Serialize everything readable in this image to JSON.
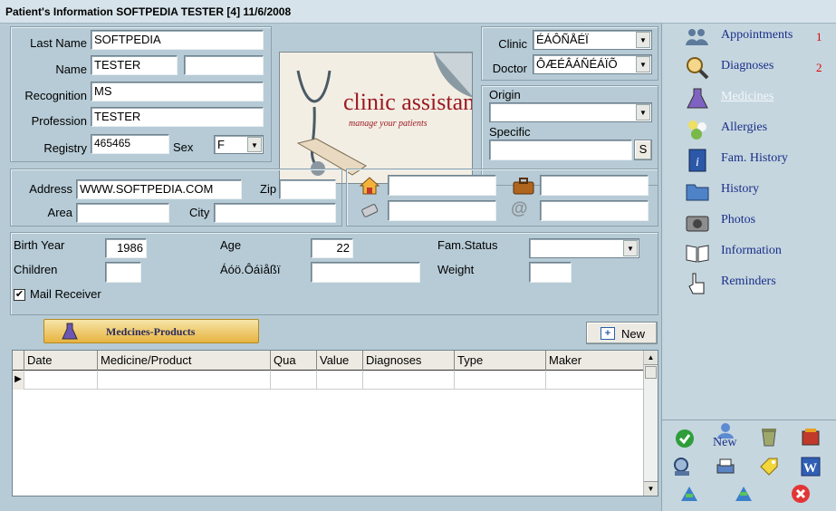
{
  "window": {
    "title": "Patient's Information SOFTPEDIA TESTER  [4] 11/6/2008"
  },
  "personal": {
    "last_name": {
      "label": "Last Name",
      "value": "SOFTPEDIA"
    },
    "name": {
      "label": "Name",
      "value": "TESTER",
      "value2": ""
    },
    "recognition": {
      "label": "Recognition",
      "value": "MS"
    },
    "profession": {
      "label": "Profession",
      "value": "TESTER"
    },
    "registry": {
      "label": "Registry",
      "value": "465465"
    },
    "sex": {
      "label": "Sex",
      "value": "F"
    }
  },
  "logo": {
    "title": "clinic assistant",
    "tagline": "manage your patients"
  },
  "assignment": {
    "clinic": {
      "label": "Clinic",
      "value": "ÉÁÔÑÅÉÏ"
    },
    "doctor": {
      "label": "Doctor",
      "value": "ÔÆÉÂÁÑÉÁÏÕ"
    },
    "origin": {
      "label": "Origin",
      "value": ""
    },
    "specific": {
      "label": "Specific",
      "value": "",
      "button": "S"
    }
  },
  "address": {
    "address": {
      "label": "Address",
      "value": "WWW.SOFTPEDIA.COM"
    },
    "zip": {
      "label": "Zip",
      "value": ""
    },
    "area": {
      "label": "Area",
      "value": ""
    },
    "city": {
      "label": "City",
      "value": ""
    }
  },
  "contacts": {
    "home_phone": "",
    "work_phone": "",
    "mobile": "",
    "email": ""
  },
  "details": {
    "birth_year": {
      "label": "Birth Year",
      "value": "1986"
    },
    "age": {
      "label": "Age",
      "value": "22"
    },
    "fam_status": {
      "label": "Fam.Status",
      "value": ""
    },
    "children": {
      "label": "Children",
      "value": ""
    },
    "extra": {
      "label": "Áóö.Ôáìåßï",
      "value": ""
    },
    "weight": {
      "label": "Weight",
      "value": ""
    },
    "mail_receiver": {
      "label": "Mail Receiver",
      "checked": true
    }
  },
  "medicines": {
    "tab_label": "Medcines-Products",
    "new_button": "New",
    "columns": [
      "Date",
      "Medicine/Product",
      "Qua",
      "Value",
      "Diagnoses",
      "Type",
      "Maker"
    ],
    "row_marker": "▶"
  },
  "sidebar": {
    "items": [
      {
        "label": "Appointments",
        "count": "1",
        "icon": "people-icon"
      },
      {
        "label": "Diagnoses",
        "count": "2",
        "icon": "magnifier-icon"
      },
      {
        "label": "Medicines",
        "count": "",
        "icon": "flask-icon"
      },
      {
        "label": "Allergies",
        "count": "",
        "icon": "flower-icon"
      },
      {
        "label": "Fam. History",
        "count": "",
        "icon": "info-book-icon"
      },
      {
        "label": "History",
        "count": "",
        "icon": "folder-icon"
      },
      {
        "label": "Photos",
        "count": "",
        "icon": "camera-icon"
      },
      {
        "label": "Information",
        "count": "",
        "icon": "open-book-icon"
      },
      {
        "label": "Reminders",
        "count": "",
        "icon": "hand-pointer-icon"
      }
    ],
    "toolbar_new_label": "New"
  },
  "colors": {
    "nav_text": "#1a2f88",
    "count_text": "#dd0000",
    "background": "#b6cbd6"
  }
}
